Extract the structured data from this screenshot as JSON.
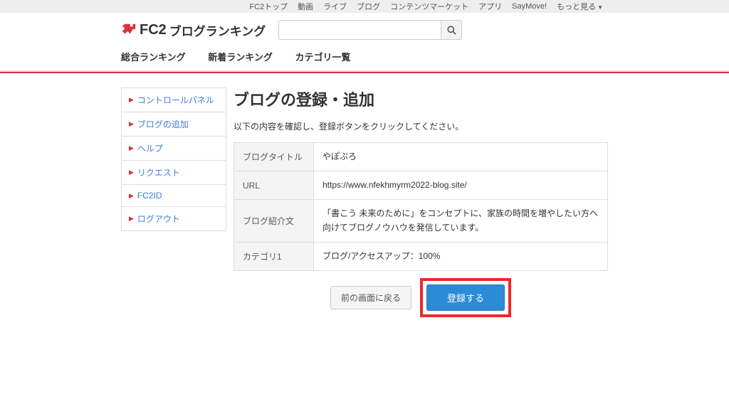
{
  "topbar": {
    "items": [
      "FC2トップ",
      "動画",
      "ライブ",
      "ブログ",
      "コンテンツマーケット",
      "アプリ",
      "SayMove!",
      "もっと見る"
    ]
  },
  "logo": {
    "brand": "FC2",
    "sub": "ブログランキング"
  },
  "search": {
    "placeholder": ""
  },
  "nav": {
    "items": [
      "総合ランキング",
      "新着ランキング",
      "カテゴリ一覧"
    ]
  },
  "sidebar": {
    "items": [
      {
        "label": "コントロールパネル"
      },
      {
        "label": "ブログの追加"
      },
      {
        "label": "ヘルプ"
      },
      {
        "label": "リクエスト"
      },
      {
        "label": "FC2ID"
      },
      {
        "label": "ログアウト"
      }
    ]
  },
  "main": {
    "title": "ブログの登録・追加",
    "instruction": "以下の内容を確認し、登録ボタンをクリックしてください。",
    "rows": [
      {
        "label": "ブログタイトル",
        "value": "やぽぶろ"
      },
      {
        "label": "URL",
        "value": "https://www.nfekhmyrm2022-blog.site/"
      },
      {
        "label": "ブログ紹介文",
        "value": "「書こう 未来のために」をコンセプトに、家族の時間を増やしたい方へ向けてブログノウハウを発信しています。"
      },
      {
        "label": "カテゴリ1",
        "value": "ブログ/アクセスアップ：100%"
      }
    ],
    "buttons": {
      "back": "前の画面に戻る",
      "register": "登録する"
    }
  }
}
